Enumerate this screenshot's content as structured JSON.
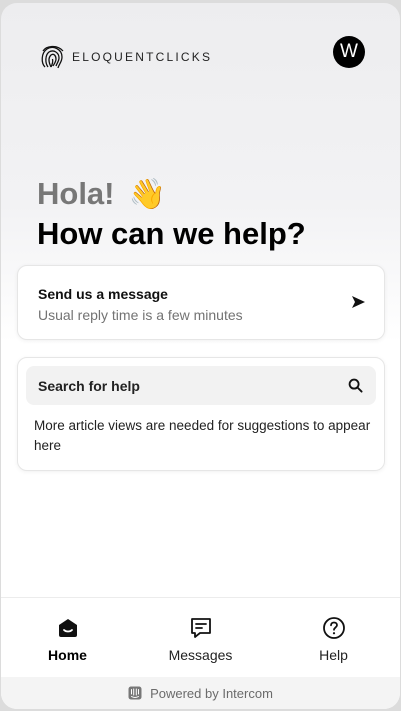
{
  "header": {
    "brand_name": "ELOQUENTCLICKS",
    "logo_icon": "fingerprint-icon",
    "avatar_initial": "W"
  },
  "hero": {
    "greeting": "Hola!",
    "greeting_emoji": "👋",
    "headline": "How can we help?"
  },
  "message_card": {
    "title": "Send us a message",
    "subtitle": "Usual reply time is a few minutes",
    "icon": "send-icon"
  },
  "search_card": {
    "label": "Search for help",
    "icon": "search-icon",
    "note": "More article views are needed for suggestions to appear here"
  },
  "nav": {
    "items": [
      {
        "label": "Home",
        "icon": "home-icon",
        "active": true
      },
      {
        "label": "Messages",
        "icon": "messages-icon",
        "active": false
      },
      {
        "label": "Help",
        "icon": "help-icon",
        "active": false
      }
    ]
  },
  "footer": {
    "text": "Powered by Intercom",
    "icon": "intercom-icon"
  },
  "colors": {
    "accent": "#000000",
    "muted_text": "#737373",
    "greeting_gray": "#777777"
  }
}
